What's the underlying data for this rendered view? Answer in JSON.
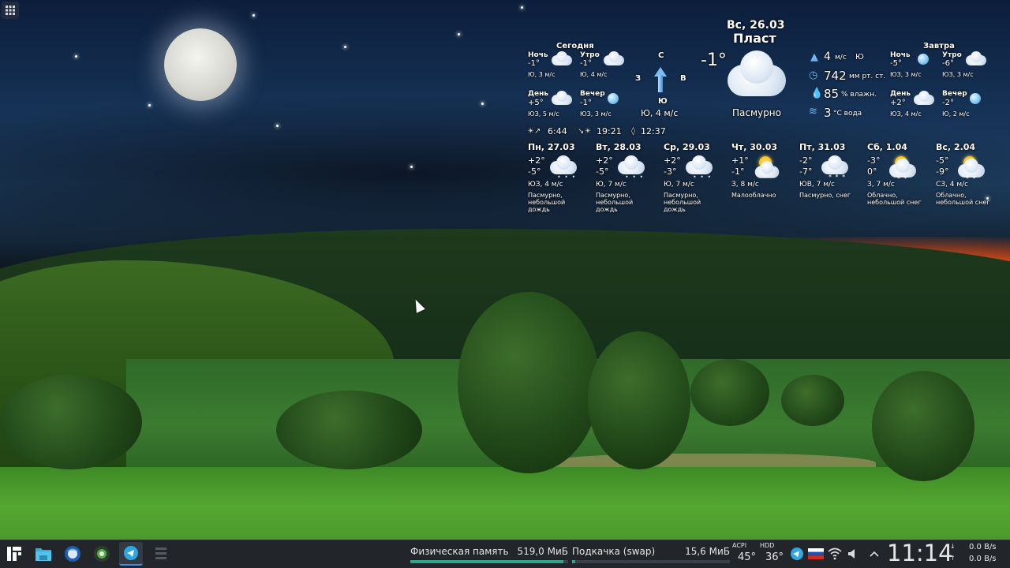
{
  "weather": {
    "date": "Вс, 26.03",
    "city": "Пласт",
    "today_title": "Сегодня",
    "tomorrow_title": "Завтра",
    "today": [
      {
        "label": "Ночь",
        "temp": "-1°",
        "wind": "Ю, 3 м/с"
      },
      {
        "label": "Утро",
        "temp": "-1°",
        "wind": "Ю, 4 м/с"
      },
      {
        "label": "День",
        "temp": "+5°",
        "wind": "ЮЗ, 5 м/с"
      },
      {
        "label": "Вечер",
        "temp": "-1°",
        "wind": "ЮЗ, 3 м/с"
      }
    ],
    "tomorrow": [
      {
        "label": "Ночь",
        "temp": "-5°",
        "wind": "ЮЗ, 3 м/с"
      },
      {
        "label": "Утро",
        "temp": "-6°",
        "wind": "ЮЗ, 3 м/с"
      },
      {
        "label": "День",
        "temp": "+2°",
        "wind": "ЮЗ, 4 м/с"
      },
      {
        "label": "Вечер",
        "temp": "-2°",
        "wind": "Ю, 2 м/с"
      }
    ],
    "compass": {
      "n": "С",
      "s": "Ю",
      "w": "З",
      "e": "В",
      "wind": "Ю, 4 м/с"
    },
    "current": {
      "temp": "-1°",
      "condition": "Пасмурно",
      "wind_value": "4",
      "wind_unit": "м/с",
      "wind_dir": "Ю",
      "pressure_value": "742",
      "pressure_unit": "мм рт. ст.",
      "humidity_value": "85",
      "humidity_unit": "% влажн.",
      "water_value": "3",
      "water_unit": "°С вода"
    },
    "sun": {
      "sunrise": "6:44",
      "sunset": "19:21",
      "daylength": "12:37"
    },
    "forecast": [
      {
        "day": "Пн, 27.03",
        "high": "+2°",
        "low": "-5°",
        "wind": "ЮЗ, 4 м/с",
        "desc1": "Пасмурно,",
        "desc2": "небольшой",
        "desc3": "дождь"
      },
      {
        "day": "Вт, 28.03",
        "high": "+2°",
        "low": "-5°",
        "wind": "Ю, 7 м/с",
        "desc1": "Пасмурно,",
        "desc2": "небольшой",
        "desc3": "дождь"
      },
      {
        "day": "Ср, 29.03",
        "high": "+2°",
        "low": "-3°",
        "wind": "Ю, 7 м/с",
        "desc1": "Пасмурно,",
        "desc2": "небольшой",
        "desc3": "дождь"
      },
      {
        "day": "Чт, 30.03",
        "high": "+1°",
        "low": "-1°",
        "wind": "З, 8 м/с",
        "desc1": "Малооблачно",
        "desc2": "",
        "desc3": ""
      },
      {
        "day": "Пт, 31.03",
        "high": "-2°",
        "low": "-7°",
        "wind": "ЮВ, 7 м/с",
        "desc1": "Пасмурно, снег",
        "desc2": "",
        "desc3": ""
      },
      {
        "day": "Сб, 1.04",
        "high": "-3°",
        "low": "0°",
        "wind": "З, 7 м/с",
        "desc1": "Облачно,",
        "desc2": "небольшой снег",
        "desc3": ""
      },
      {
        "day": "Вс, 2.04",
        "high": "-5°",
        "low": "-9°",
        "wind": "СЗ, 4 м/с",
        "desc1": "Облачно,",
        "desc2": "небольшой снег",
        "desc3": ""
      }
    ]
  },
  "taskbar": {
    "memory_label": "Физическая память",
    "memory_value": "519,0 МиБ",
    "memory_fraction": 0.97,
    "swap_label": "Подкачка (swap)",
    "swap_value": "15,6 МиБ",
    "swap_fraction": 0.02,
    "acpi_label": "ACPI",
    "acpi_value": "45°",
    "hdd_label": "HDD",
    "hdd_value": "36°",
    "clock": "11:14",
    "net_down": "0.0 B/s",
    "net_up": "0.0 B/s"
  },
  "icons": [
    "app-menu-icon",
    "file-manager-icon",
    "thunderbird-icon",
    "browser-icon",
    "telegram-icon",
    "window-icon",
    "telegram-tray-icon",
    "keyboard-layout-flag-icon",
    "wifi-icon",
    "volume-icon",
    "tray-expand-icon"
  ],
  "colors": {
    "accent": "#3d8ee0",
    "memory_bar": "#2fa58a",
    "taskbar_bg": "#22252a"
  }
}
